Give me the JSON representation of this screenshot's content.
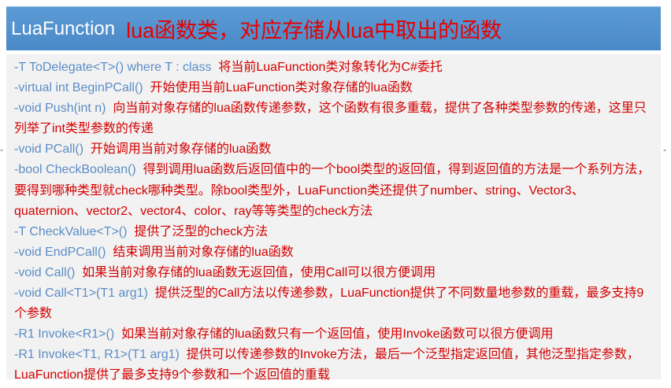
{
  "header": {
    "title_en": "LuaFunction",
    "title_cn": "lua函数类，对应存储从lua中取出的函数"
  },
  "items": [
    {
      "sig": "-T ToDelegate<T>() where T : class",
      "desc": "将当前LuaFunction类对象转化为C#委托"
    },
    {
      "sig": "-virtual int BeginPCall()",
      "desc": "开始使用当前LuaFunction类对象存储的lua函数"
    },
    {
      "sig": "-void Push(int n)",
      "desc": "向当前对象存储的lua函数传递参数，这个函数有很多重载，提供了各种类型参数的传递，这里只列举了int类型参数的传递"
    },
    {
      "sig": "-void PCall()",
      "desc": "开始调用当前对象存储的lua函数"
    },
    {
      "sig": "-bool CheckBoolean()",
      "desc": "得到调用lua函数后返回值中的一个bool类型的返回值，得到返回值的方法是一个系列方法，要得到哪种类型就check哪种类型。除bool类型外，LuaFunction类还提供了number、string、Vector3、quaternion、vector2、vector4、color、ray等等类型的check方法"
    },
    {
      "sig": "-T CheckValue<T>()",
      "desc": "提供了泛型的check方法"
    },
    {
      "sig": "-void EndPCall()",
      "desc": "结束调用当前对象存储的lua函数"
    },
    {
      "sig": "-void Call()",
      "desc": "如果当前对象存储的lua函数无返回值，使用Call可以很方便调用"
    },
    {
      "sig": "-void Call<T1>(T1 arg1)",
      "desc": "提供泛型的Call方法以传递参数，LuaFunction提供了不同数量地参数的重载，最多支持9个参数"
    },
    {
      "sig": "-R1 Invoke<R1>()",
      "desc": "如果当前对象存储的lua函数只有一个返回值，使用Invoke函数可以很方便调用"
    },
    {
      "sig": "-R1 Invoke<T1, R1>(T1 arg1)",
      "desc": "提供可以传递参数的Invoke方法，最后一个泛型指定返回值，其他泛型指定参数，LuaFunction提供了最多支持9个参数和一个返回值的重载"
    }
  ],
  "marks": {
    "dash_left": "-",
    "dash_right": "-"
  }
}
